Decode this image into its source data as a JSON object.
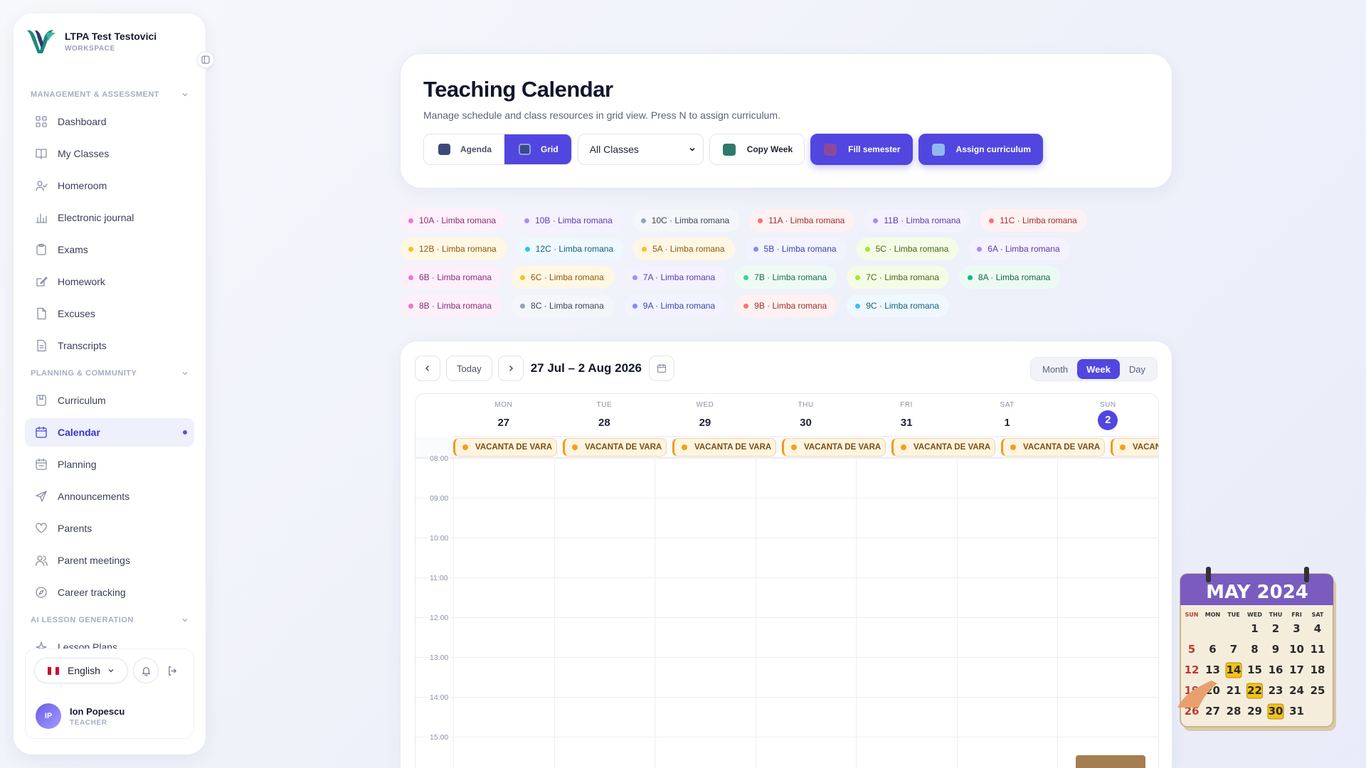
{
  "workspace": {
    "name": "LTPA Test Testovici",
    "label": "WORKSPACE"
  },
  "sidebar": {
    "sections": [
      {
        "title": "MANAGEMENT & ASSESSMENT",
        "items": [
          {
            "label": "Dashboard",
            "icon": "grid-icon"
          },
          {
            "label": "My Classes",
            "icon": "book-icon"
          },
          {
            "label": "Homeroom",
            "icon": "user-check-icon"
          },
          {
            "label": "Electronic journal",
            "icon": "bar-chart-icon"
          },
          {
            "label": "Exams",
            "icon": "clipboard-icon"
          },
          {
            "label": "Homework",
            "icon": "edit-icon"
          },
          {
            "label": "Excuses",
            "icon": "file-icon"
          },
          {
            "label": "Transcripts",
            "icon": "document-icon"
          }
        ]
      },
      {
        "title": "PLANNING & COMMUNITY",
        "items": [
          {
            "label": "Curriculum",
            "icon": "bookmark-icon"
          },
          {
            "label": "Calendar",
            "icon": "calendar-icon",
            "active": true
          },
          {
            "label": "Planning",
            "icon": "calendar-check-icon"
          },
          {
            "label": "Announcements",
            "icon": "send-icon"
          },
          {
            "label": "Parents",
            "icon": "heart-icon"
          },
          {
            "label": "Parent meetings",
            "icon": "users-icon"
          },
          {
            "label": "Career tracking",
            "icon": "compass-icon"
          }
        ]
      },
      {
        "title": "AI LESSON GENERATION",
        "items": [
          {
            "label": "Lesson Plans",
            "icon": "sparkle-icon"
          }
        ]
      }
    ],
    "language": "English",
    "user": {
      "initials": "IP",
      "name": "Ion Popescu",
      "role": "TEACHER"
    }
  },
  "header": {
    "title": "Teaching Calendar",
    "subtitle": "Manage schedule and class resources in grid view. Press N to assign curriculum.",
    "view_agenda": "Agenda",
    "view_grid": "Grid",
    "class_filter": "All Classes",
    "copy_week": "Copy Week",
    "fill_semester": "Fill semester",
    "assign_curriculum": "Assign curriculum"
  },
  "class_chips": [
    [
      {
        "label": "10A · Limba romana",
        "color": "#e879c9",
        "bg": "#fdf0fa",
        "fg": "#8a2d72"
      },
      {
        "label": "10B · Limba romana",
        "color": "#a78bfa",
        "bg": "#f5f2ff",
        "fg": "#5b3aa8"
      },
      {
        "label": "10C · Limba romana",
        "color": "#94a3b8",
        "bg": "#f4f6f9",
        "fg": "#3d4556"
      },
      {
        "label": "11A · Limba romana",
        "color": "#f87171",
        "bg": "#fef1f1",
        "fg": "#a12e2e"
      },
      {
        "label": "11B · Limba romana",
        "color": "#a78bfa",
        "bg": "#f5f2ff",
        "fg": "#5b3aa8"
      },
      {
        "label": "11C · Limba romana",
        "color": "#f87171",
        "bg": "#fef1f1",
        "fg": "#a12e2e"
      }
    ],
    [
      {
        "label": "12B · Limba romana",
        "color": "#fbbf24",
        "bg": "#fff7e4",
        "fg": "#8a5a10"
      },
      {
        "label": "12C · Limba romana",
        "color": "#38bdf8",
        "bg": "#eef8fe",
        "fg": "#19607e"
      },
      {
        "label": "5A · Limba romana",
        "color": "#fbbf24",
        "bg": "#fff7e4",
        "fg": "#8a5a10"
      },
      {
        "label": "5B · Limba romana",
        "color": "#818cf8",
        "bg": "#f2f3ff",
        "fg": "#3d44a8"
      },
      {
        "label": "5C · Limba romana",
        "color": "#a3e635",
        "bg": "#f5fce6",
        "fg": "#46661a"
      },
      {
        "label": "6A · Limba romana",
        "color": "#a78bfa",
        "bg": "#f5f2ff",
        "fg": "#5b3aa8"
      }
    ],
    [
      {
        "label": "6B · Limba romana",
        "color": "#e879c9",
        "bg": "#fdf0fa",
        "fg": "#8a2d72"
      },
      {
        "label": "6C · Limba romana",
        "color": "#fbbf24",
        "bg": "#fff7e4",
        "fg": "#8a5a10"
      },
      {
        "label": "7A · Limba romana",
        "color": "#a78bfa",
        "bg": "#f5f2ff",
        "fg": "#5b3aa8"
      },
      {
        "label": "7B · Limba romana",
        "color": "#34d399",
        "bg": "#eefbf5",
        "fg": "#1d6b4e"
      },
      {
        "label": "7C · Limba romana",
        "color": "#a3e635",
        "bg": "#f5fce6",
        "fg": "#46661a"
      },
      {
        "label": "8A · Limba romana",
        "color": "#10b981",
        "bg": "#ecfaf4",
        "fg": "#16664c"
      }
    ],
    [
      {
        "label": "8B · Limba romana",
        "color": "#e879c9",
        "bg": "#fdf0fa",
        "fg": "#8a2d72"
      },
      {
        "label": "8C · Limba romana",
        "color": "#94a3b8",
        "bg": "#f4f6f9",
        "fg": "#3d4556"
      },
      {
        "label": "9A · Limba romana",
        "color": "#818cf8",
        "bg": "#f2f3ff",
        "fg": "#3d44a8"
      },
      {
        "label": "9B · Limba romana",
        "color": "#f87171",
        "bg": "#fef1f1",
        "fg": "#a12e2e"
      },
      {
        "label": "9C · Limba romana",
        "color": "#38bdf8",
        "bg": "#eef8fe",
        "fg": "#19607e"
      }
    ]
  ],
  "calendar": {
    "today_label": "Today",
    "range": "27 Jul – 2 Aug 2026",
    "modes": [
      "Month",
      "Week",
      "Day"
    ],
    "active_mode": "Week",
    "days": [
      {
        "name": "MON",
        "num": "27"
      },
      {
        "name": "TUE",
        "num": "28"
      },
      {
        "name": "WED",
        "num": "29"
      },
      {
        "name": "THU",
        "num": "30"
      },
      {
        "name": "FRI",
        "num": "31"
      },
      {
        "name": "SAT",
        "num": "1"
      },
      {
        "name": "SUN",
        "num": "2",
        "today": true
      }
    ],
    "allday_event": "VACANTA DE VARA",
    "hours": [
      "08:00",
      "09:00",
      "10:00",
      "11:00",
      "12:00",
      "13:00",
      "14:00",
      "15:00"
    ]
  },
  "decor": {
    "month_title": "MAY 2024",
    "weekdays": [
      "SUN",
      "MON",
      "TUE",
      "WED",
      "THU",
      "FRI",
      "SAT"
    ],
    "weeks": [
      [
        "",
        "",
        "",
        "1",
        "2",
        "3",
        "4"
      ],
      [
        "5",
        "6",
        "7",
        "8",
        "9",
        "10",
        "11"
      ],
      [
        "12",
        "13",
        "14",
        "15",
        "16",
        "17",
        "18"
      ],
      [
        "19",
        "20",
        "21",
        "22",
        "23",
        "24",
        "25"
      ],
      [
        "26",
        "27",
        "28",
        "29",
        "30",
        "31",
        ""
      ]
    ],
    "highlighted": [
      "14",
      "22",
      "30"
    ]
  },
  "colors": {
    "accent": "#5146e0",
    "active_bg": "#eef0fc",
    "event": "#f0a020"
  }
}
